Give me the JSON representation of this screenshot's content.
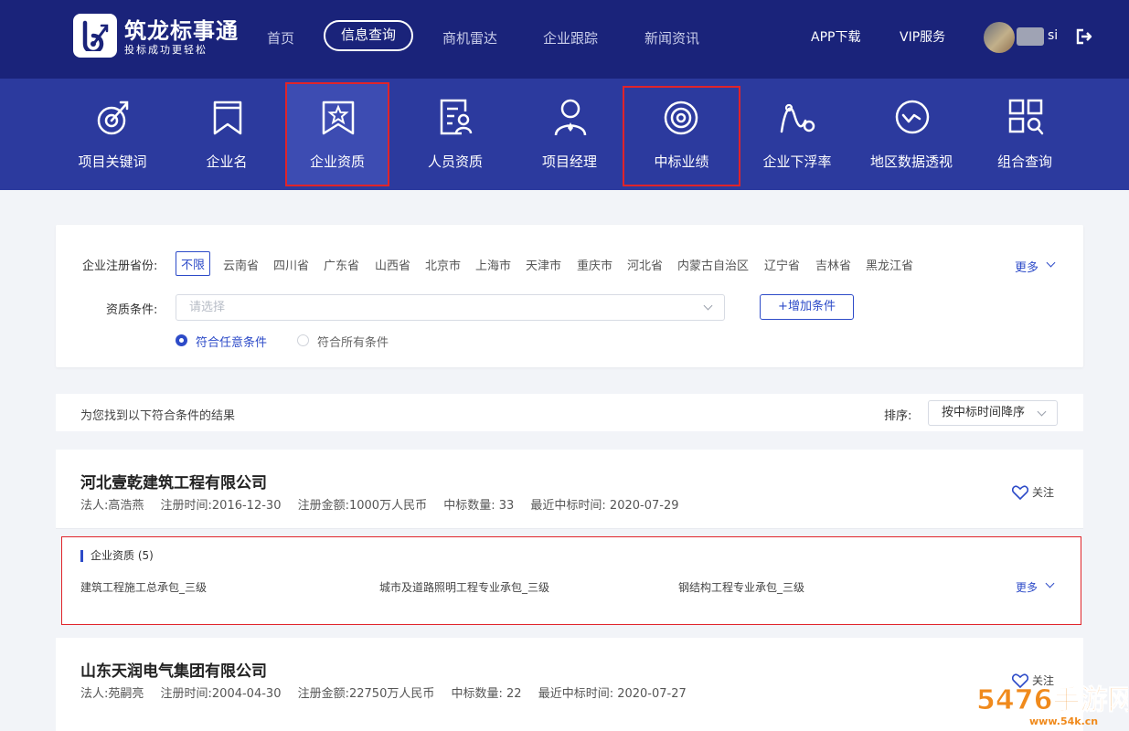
{
  "brand": {
    "name": "筑龙标事通",
    "slogan": "投标成功更轻松"
  },
  "nav": [
    "首页",
    "信息查询",
    "商机雷达",
    "企业跟踪",
    "新闻资讯"
  ],
  "nav_active": "信息查询",
  "top_links": {
    "app": "APP下载",
    "vip": "VIP服务"
  },
  "user": {
    "name": "si"
  },
  "tools": [
    {
      "label": "项目关键词",
      "icon": "target-arrow-icon"
    },
    {
      "label": "企业名",
      "icon": "bookmark-icon"
    },
    {
      "label": "企业资质",
      "icon": "star-bookmark-icon"
    },
    {
      "label": "人员资质",
      "icon": "person-card-icon"
    },
    {
      "label": "项目经理",
      "icon": "manager-icon"
    },
    {
      "label": "中标业绩",
      "icon": "bullseye-icon"
    },
    {
      "label": "企业下浮率",
      "icon": "wave-line-icon"
    },
    {
      "label": "地区数据透视",
      "icon": "map-wave-icon"
    },
    {
      "label": "组合查询",
      "icon": "grid-search-icon"
    }
  ],
  "filter": {
    "province_label": "企业注册省份:",
    "provinces": [
      "不限",
      "云南省",
      "四川省",
      "广东省",
      "山西省",
      "北京市",
      "上海市",
      "天津市",
      "重庆市",
      "河北省",
      "内蒙古自治区",
      "辽宁省",
      "吉林省",
      "黑龙江省"
    ],
    "more": "更多",
    "qual_label": "资质条件:",
    "qual_placeholder": "请选择",
    "add_condition": "+增加条件",
    "radio_any": "符合任意条件",
    "radio_all": "符合所有条件"
  },
  "results": {
    "summary": "为您找到以下符合条件的结果",
    "sort_label": "排序:",
    "sort_value": "按中标时间降序"
  },
  "companies": [
    {
      "name": "河北壹乾建筑工程有限公司",
      "legal_person": "法人:高浩燕",
      "reg_date": "注册时间:2016-12-30",
      "reg_capital": "注册金额:1000万人民币",
      "bid_count": "中标数量: 33",
      "last_bid": "最近中标时间: 2020-07-29",
      "follow": "关注",
      "qual_title": "企业资质 (5)",
      "quals": [
        "建筑工程施工总承包_三级",
        "城市及道路照明工程专业承包_三级",
        "钢结构工程专业承包_三级"
      ],
      "qual_more": "更多"
    },
    {
      "name": "山东天润电气集团有限公司",
      "legal_person": "法人:苑嗣亮",
      "reg_date": "注册时间:2004-04-30",
      "reg_capital": "注册金额:22750万人民币",
      "bid_count": "中标数量: 22",
      "last_bid": "最近中标时间: 2020-07-27",
      "follow": "关注"
    }
  ],
  "colors": {
    "nav_bg": "#1a237a",
    "toolbar_bg": "#2c3a9e",
    "accent": "#2d4bc8",
    "highlight": "#e0242a"
  },
  "watermark": {
    "text": "5476手游网",
    "url": "www.54k.cn"
  }
}
